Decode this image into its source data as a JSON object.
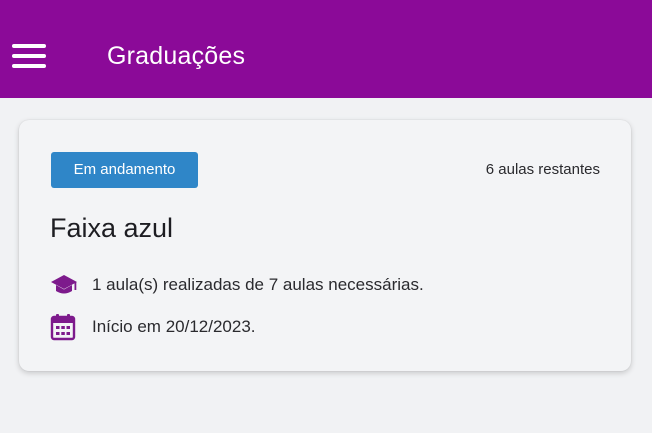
{
  "app_bar": {
    "title": "Graduações",
    "menu_icon": "hamburger-menu-icon",
    "color": "#8b0a98"
  },
  "card": {
    "status_badge": "Em andamento",
    "status_color": "#2f86c8",
    "remaining": "6 aulas restantes",
    "belt_name": "Faixa azul",
    "progress": {
      "icon": "graduation-cap-icon",
      "text": "1 aula(s) realizadas de 7 aulas necessárias."
    },
    "start": {
      "icon": "calendar-icon",
      "text": "Início em 20/12/2023."
    }
  }
}
